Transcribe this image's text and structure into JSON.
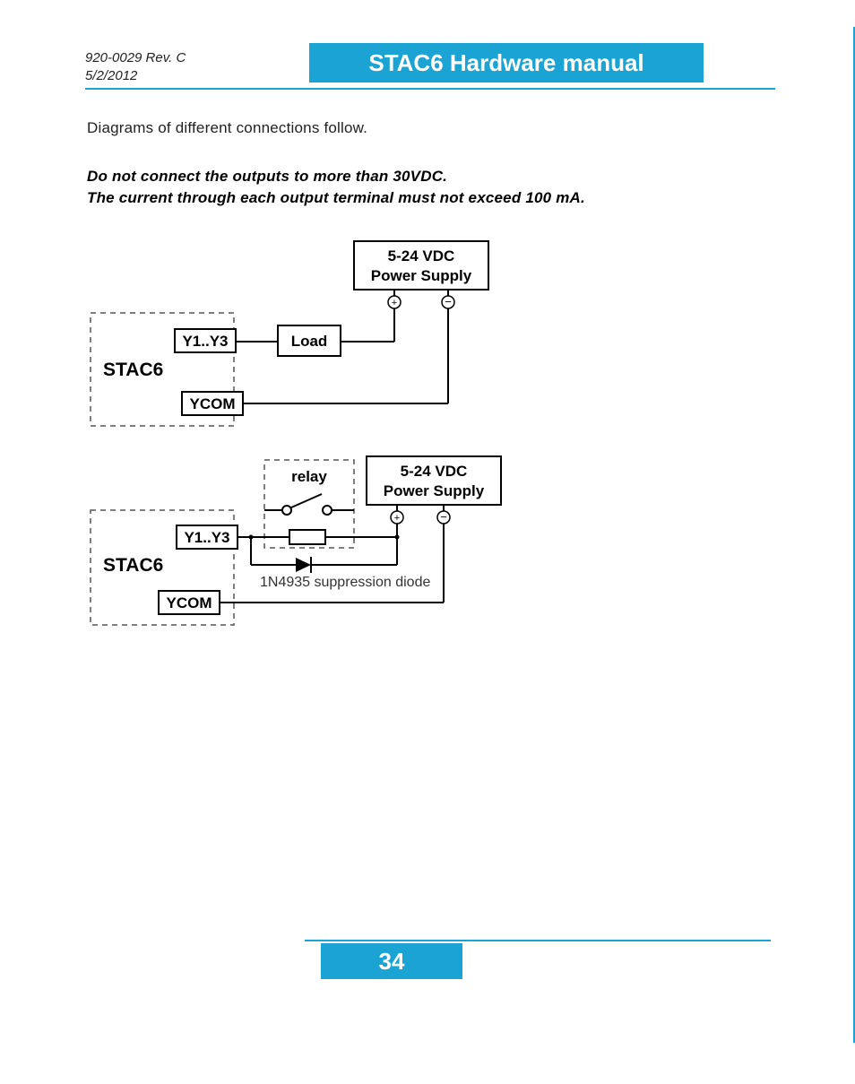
{
  "header": {
    "doc_rev": "920-0029 Rev. C",
    "doc_date": "5/2/2012",
    "title": "STAC6 Hardware manual"
  },
  "body": {
    "intro": "Diagrams of different connections  follow.",
    "warning_line1": "Do not connect the outputs to more than 30VDC.",
    "warning_line2": "The current through each output terminal must not exceed 100 mA."
  },
  "diagram1": {
    "power_supply_l1": "5-24 VDC",
    "power_supply_l2": "Power Supply",
    "load": "Load",
    "device": "STAC6",
    "y_label": "Y1..Y3",
    "ycom": "YCOM"
  },
  "diagram2": {
    "power_supply_l1": "5-24 VDC",
    "power_supply_l2": "Power Supply",
    "relay": "relay",
    "device": "STAC6",
    "y_label": "Y1..Y3",
    "ycom": "YCOM",
    "diode_note": "1N4935 suppression diode"
  },
  "footer": {
    "page_number": "34"
  }
}
